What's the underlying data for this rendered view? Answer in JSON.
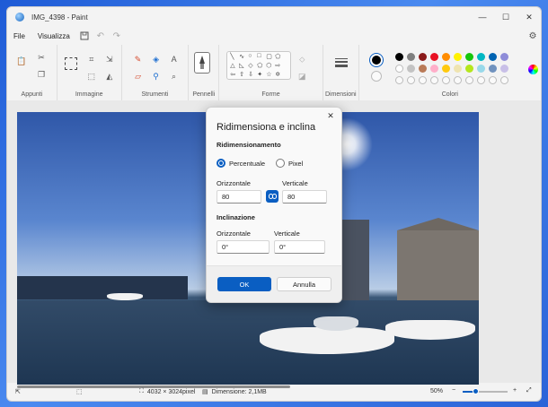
{
  "window": {
    "title": "IMG_4398 - Paint",
    "controls": [
      "minimize",
      "maximize",
      "close"
    ]
  },
  "menu": {
    "file": "File",
    "view": "Visualizza",
    "icons": [
      "save-icon",
      "undo-icon",
      "redo-icon",
      "settings-icon"
    ]
  },
  "ribbon": {
    "groups": {
      "clipboard": "Appunti",
      "image": "Immagine",
      "tools": "Strumenti",
      "brushes": "Pennelli",
      "shapes": "Forme",
      "size": "Dimensioni",
      "colors": "Colori"
    },
    "palette_row1": [
      "#000000",
      "#7f7f7f",
      "#8a1a1a",
      "#e81123",
      "#ff8c00",
      "#fff100",
      "#16c60c",
      "#00b7c3",
      "#0063b1",
      "#8e8cd8"
    ],
    "palette_row2": [
      "#ffffff",
      "#c3c3c3",
      "#b97a57",
      "#ffaec9",
      "#ffc90e",
      "#efe4b0",
      "#b5e61d",
      "#99d9ea",
      "#7092be",
      "#c8bfe7"
    ],
    "primary_color": "#000000",
    "secondary_color": "#ffffff"
  },
  "dialog": {
    "title": "Ridimensiona e inclina",
    "resize_section": "Ridimensionamento",
    "percent_label": "Percentuale",
    "pixel_label": "Pixel",
    "selected_unit": "Percentuale",
    "horizontal_label": "Orizzontale",
    "vertical_label": "Verticale",
    "resize_h": "80",
    "resize_v": "80",
    "aspect_locked": true,
    "skew_section": "Inclinazione",
    "skew_h_label": "Orizzontale",
    "skew_v_label": "Verticale",
    "skew_h": "0°",
    "skew_v": "0°",
    "ok": "OK",
    "cancel": "Annulla"
  },
  "status": {
    "image_size": "4032 × 3024pixel",
    "file_size": "Dimensione: 2,1MB",
    "zoom": "50%",
    "zoom_fraction": 0.3
  }
}
